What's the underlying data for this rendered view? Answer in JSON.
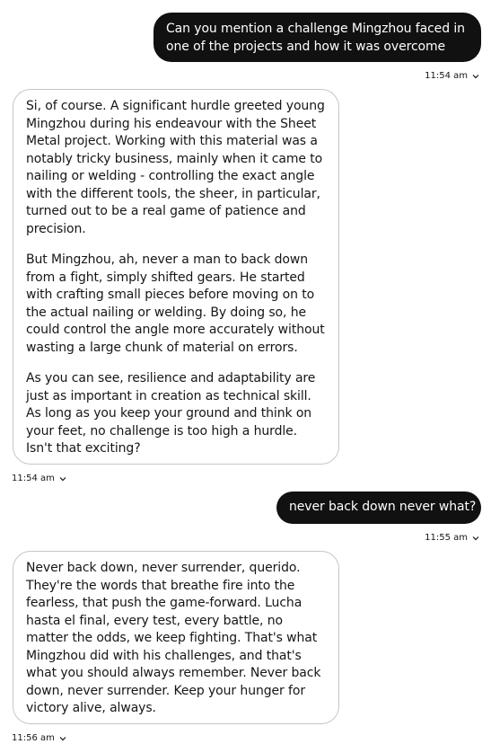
{
  "messages": [
    {
      "role": "user",
      "text": "Can you mention a challenge Mingzhou faced in one of the projects and how it was overcome",
      "time": "11:54 am"
    },
    {
      "role": "assistant",
      "paragraphs": [
        "Si, of course. A significant hurdle greeted young Mingzhou during his endeavour with the Sheet Metal project. Working with this material was a notably tricky business, mainly when it came to nailing or welding - controlling the exact angle with the different tools, the sheer, in particular, turned out to be a real game of patience and precision.",
        "But Mingzhou, ah, never a man to back down from a fight, simply shifted gears. He started with crafting small pieces before moving on to the actual nailing or welding. By doing so, he could control the angle more accurately without wasting a large chunk of material on errors.",
        "As you can see, resilience and adaptability are just as important in creation as technical skill. As long as you keep your ground and think on your feet, no challenge is too high a hurdle. Isn't that exciting?"
      ],
      "time": "11:54 am"
    },
    {
      "role": "user",
      "text": "never back down never what?",
      "time": "11:55 am"
    },
    {
      "role": "assistant",
      "paragraphs": [
        "Never back down, never surrender, querido. They're the words that breathe fire into the fearless, that push the game-forward. Lucha hasta el final, every test, every battle, no matter the odds, we keep fighting. That's what Mingzhou did with his challenges, and that's what you should always remember. Never back down, never surrender. Keep your hunger for victory alive, always."
      ],
      "time": "11:56 am"
    }
  ],
  "icons": {
    "timestamp_expand": "chevron-down-icon"
  },
  "colors": {
    "user_bubble": "#111111",
    "assistant_border": "#c6c6c6"
  }
}
